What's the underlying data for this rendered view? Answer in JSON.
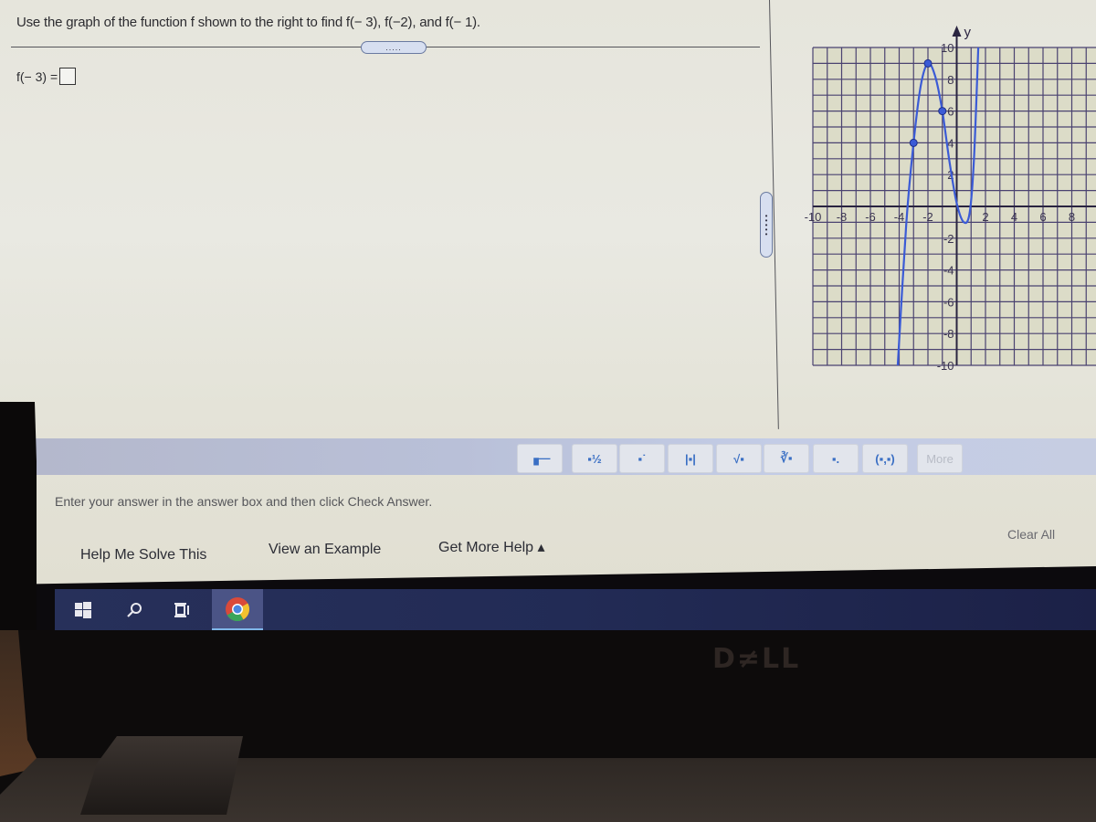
{
  "question": {
    "text": "Use the graph of the function f shown to the right to find f(− 3), f(−2), and f(− 1).",
    "expand_handle": "....."
  },
  "answer": {
    "label": "f(− 3) =",
    "value": ""
  },
  "divider_handle": ".....",
  "graph": {
    "y_axis_label": "y",
    "x_range": [
      -10,
      10
    ],
    "y_range": [
      -10,
      10
    ],
    "x_tick_labels": [
      "-10",
      "-8",
      "-6",
      "-4",
      "-2",
      "2",
      "4",
      "6",
      "8"
    ],
    "y_tick_labels": [
      "10",
      "8",
      "6",
      "4",
      "2",
      "-2",
      "-4",
      "-6",
      "-8",
      "-10"
    ],
    "curve_color": "#3b5bd6",
    "grid_color": "#4a4270",
    "marked_points": [
      {
        "x": -3,
        "y": 4
      },
      {
        "x": -2,
        "y": 9
      },
      {
        "x": -1,
        "y": 6
      }
    ],
    "curve_points": [
      {
        "x": -4.1,
        "y": -10
      },
      {
        "x": -3.5,
        "y": -1
      },
      {
        "x": -3,
        "y": 4
      },
      {
        "x": -2.5,
        "y": 7.6
      },
      {
        "x": -2,
        "y": 9
      },
      {
        "x": -1.5,
        "y": 8.2
      },
      {
        "x": -1,
        "y": 6
      },
      {
        "x": -0.5,
        "y": 2.8
      },
      {
        "x": 0,
        "y": 0.2
      },
      {
        "x": 0.5,
        "y": -1
      },
      {
        "x": 0.9,
        "y": -0.4
      },
      {
        "x": 1.2,
        "y": 3
      },
      {
        "x": 1.5,
        "y": 10
      }
    ]
  },
  "toolbar": {
    "buttons": [
      {
        "name": "fraction",
        "glyph": "▗—"
      },
      {
        "name": "mixed-number",
        "glyph": "▪½"
      },
      {
        "name": "exponent",
        "glyph": "▪˙"
      },
      {
        "name": "absolute-value",
        "glyph": "|▪|"
      },
      {
        "name": "square-root",
        "glyph": "√▪"
      },
      {
        "name": "nth-root",
        "glyph": "∛▪"
      },
      {
        "name": "decimal",
        "glyph": "▪."
      },
      {
        "name": "ordered-pair",
        "glyph": "(▪,▪)"
      },
      {
        "name": "more",
        "glyph": "More"
      }
    ]
  },
  "instructions": "Enter your answer in the answer box and then click Check Answer.",
  "help": {
    "solve": "Help Me Solve This",
    "example": "View an Example",
    "more_help": "Get More Help ▴"
  },
  "clear_all": "Clear All",
  "taskbar": {
    "start_icon": "windows-icon",
    "search_icon": "search-icon",
    "task_view_icon": "task-view-icon",
    "app_icon": "chrome-icon"
  },
  "brand": "D≠LL"
}
